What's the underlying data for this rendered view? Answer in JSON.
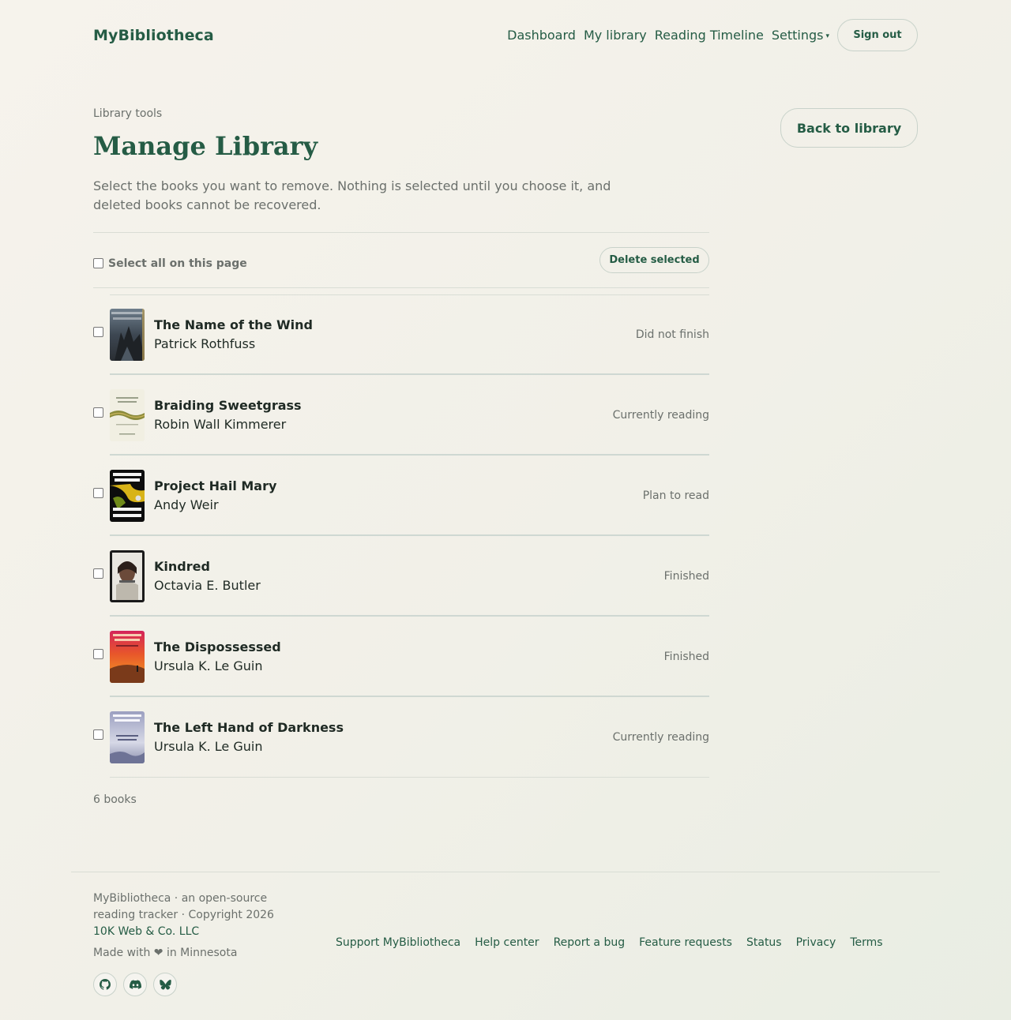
{
  "header": {
    "brand": "MyBibliotheca",
    "nav": [
      "Dashboard",
      "My library",
      "Reading Timeline",
      "Settings"
    ],
    "settings_caret": "▾",
    "sign_out": "Sign out"
  },
  "page": {
    "eyebrow": "Library tools",
    "title": "Manage Library",
    "back_label": "Back to library",
    "intro": "Select the books you want to remove. Nothing is selected until you choose it, and deleted books cannot be recovered."
  },
  "toolbar": {
    "select_all_label": "Select all on this page",
    "delete_label": "Delete selected"
  },
  "books": [
    {
      "title": "The Name of the Wind",
      "author": "Patrick Rothfuss",
      "status": "Did not finish",
      "checked": false
    },
    {
      "title": "Braiding Sweetgrass",
      "author": "Robin Wall Kimmerer",
      "status": "Currently reading",
      "checked": false
    },
    {
      "title": "Project Hail Mary",
      "author": "Andy Weir",
      "status": "Plan to read",
      "checked": false
    },
    {
      "title": "Kindred",
      "author": "Octavia E. Butler",
      "status": "Finished",
      "checked": false
    },
    {
      "title": "The Dispossessed",
      "author": "Ursula K. Le Guin",
      "status": "Finished",
      "checked": false
    },
    {
      "title": "The Left Hand of Darkness",
      "author": "Ursula K. Le Guin",
      "status": "Currently reading",
      "checked": false
    }
  ],
  "count_label": "6 books",
  "footer": {
    "text": "MyBibliotheca · an open-source reading tracker · Copyright 2026",
    "company": "10K Web & Co. LLC",
    "made_with": "Made with ❤ in Minnesota",
    "socials": [
      "github-icon",
      "discord-icon",
      "bluesky-icon"
    ],
    "links": [
      "Support MyBibliotheca",
      "Help center",
      "Report a bug",
      "Feature requests",
      "Status",
      "Privacy",
      "Terms"
    ]
  },
  "colors": {
    "accent": "#255c45",
    "muted": "#6b706c",
    "background": "#f3f1ea"
  }
}
